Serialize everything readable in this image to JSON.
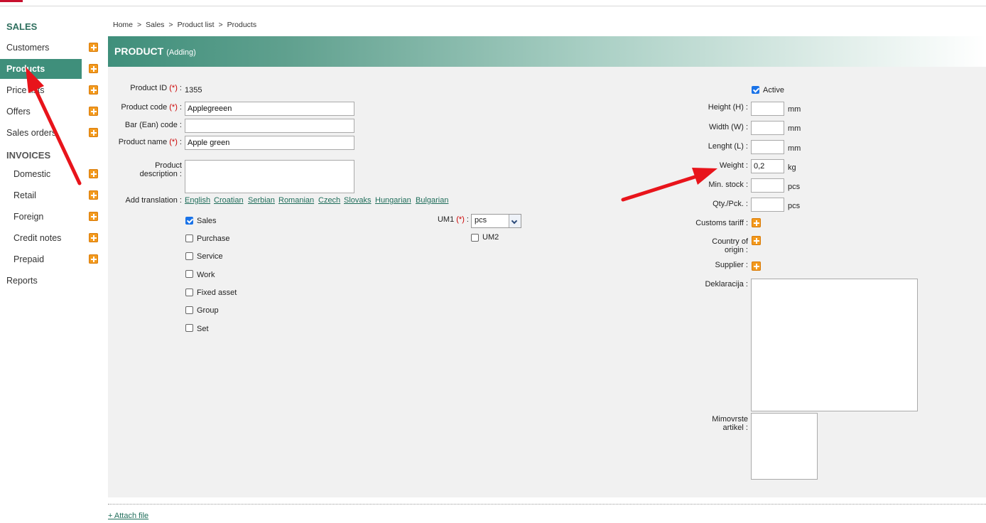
{
  "breadcrumb": [
    "Home",
    "Sales",
    "Product list",
    "Products"
  ],
  "breadcrumb_sep": ">",
  "sidebar": {
    "sales_heading": "SALES",
    "invoices_heading": "INVOICES",
    "items": [
      {
        "label": "Customers"
      },
      {
        "label": "Products"
      },
      {
        "label": "Price lists"
      },
      {
        "label": "Offers"
      },
      {
        "label": "Sales orders"
      },
      {
        "label": "Domestic"
      },
      {
        "label": "Retail"
      },
      {
        "label": "Foreign"
      },
      {
        "label": "Credit notes"
      },
      {
        "label": "Prepaid"
      },
      {
        "label": "Reports"
      }
    ]
  },
  "header": {
    "title": "PRODUCT",
    "subtitle": "(Adding)"
  },
  "form": {
    "required_mark": "(*)",
    "product_id_label": "Product ID",
    "product_id_value": "1355",
    "product_code_label": "Product code",
    "product_code_value": "Applegreeen",
    "bar_code_label": "Bar (Ean) code",
    "bar_code_value": "",
    "product_name_label": "Product name",
    "product_name_value": "Apple green",
    "desc_label_1": "Product",
    "desc_label_2": "description",
    "translation_label": "Add translation :",
    "languages": [
      "English",
      "Croatian",
      "Serbian",
      "Romanian",
      "Czech",
      "Slovaks",
      "Hungarian",
      "Bulgarian"
    ],
    "types": [
      {
        "label": "Sales",
        "checked": true
      },
      {
        "label": "Purchase",
        "checked": false
      },
      {
        "label": "Service",
        "checked": false
      },
      {
        "label": "Work",
        "checked": false
      },
      {
        "label": "Fixed asset",
        "checked": false
      },
      {
        "label": "Group",
        "checked": false
      },
      {
        "label": "Set",
        "checked": false
      }
    ],
    "um1_label": "UM1",
    "um1_value": "pcs",
    "um2_label": "UM2",
    "um2_checked": false,
    "active_label": "Active",
    "active_checked": true,
    "height_label": "Height (H) :",
    "height_value": "",
    "height_unit": "mm",
    "width_label": "Width (W) :",
    "width_value": "",
    "width_unit": "mm",
    "length_label": "Lenght (L) :",
    "length_value": "",
    "length_unit": "mm",
    "weight_label": "Weight :",
    "weight_value": "0,2",
    "weight_unit": "kg",
    "min_stock_label": "Min. stock :",
    "min_stock_value": "",
    "min_stock_unit": "pcs",
    "qty_label": "Qty./Pck. :",
    "qty_value": "",
    "qty_unit": "pcs",
    "customs_label": "Customs tariff :",
    "country_label_1": "Country of",
    "country_label_2": "origin :",
    "supplier_label": "Supplier :",
    "deklaracija_label": "Deklaracija :",
    "mimovrste_label_1": "Mimovrste",
    "mimovrste_label_2": "artikel :"
  },
  "attach_label": "+ Attach file",
  "colors": {
    "accent": "#3f8f7b",
    "link": "#1f6d5a",
    "annotation": "#e8141b",
    "plus_icon": "#f39a1e"
  }
}
